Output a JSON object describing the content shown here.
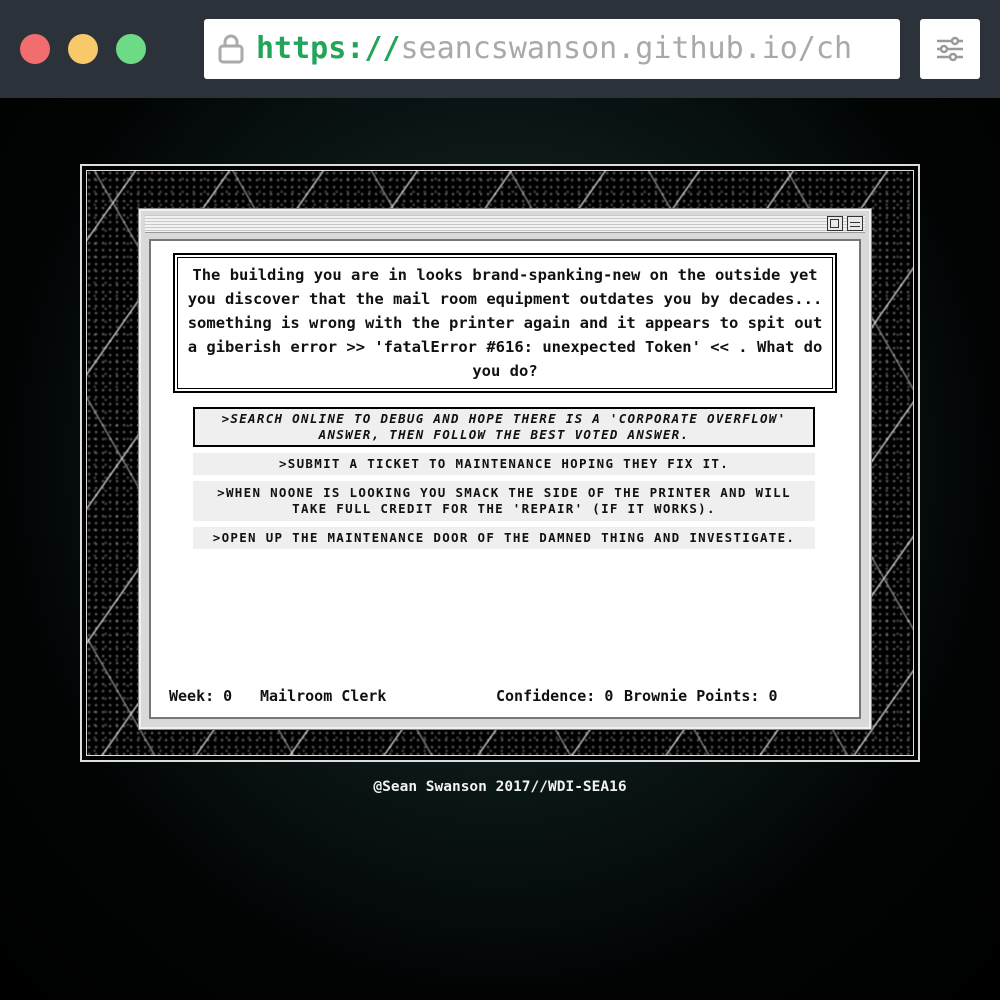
{
  "browser": {
    "url_scheme": "https://",
    "url_rest": "seancswanson.github.io/ch"
  },
  "game": {
    "story": "The building you are in looks brand-spanking-new on the outside yet you discover that the mail room equipment outdates you by decades... something is wrong with the printer again and it appears to spit out a giberish error >> 'fatalError #616: unexpected Token' << . What do you do?",
    "options": [
      {
        "label": ">SEARCH ONLINE TO DEBUG AND HOPE THERE IS A 'CORPORATE OVERFLOW' ANSWER, THEN FOLLOW THE BEST VOTED ANSWER.",
        "selected": true
      },
      {
        "label": ">SUBMIT A TICKET TO MAINTENANCE HOPING THEY FIX IT.",
        "selected": false
      },
      {
        "label": ">WHEN NOONE IS LOOKING YOU SMACK THE SIDE OF THE PRINTER AND WILL TAKE FULL CREDIT FOR THE 'REPAIR' (IF IT WORKS).",
        "selected": false
      },
      {
        "label": ">OPEN UP THE MAINTENANCE DOOR OF THE DAMNED THING AND INVESTIGATE.",
        "selected": false
      }
    ],
    "status": {
      "week": "Week: 0",
      "role": "Mailroom Clerk",
      "confidence": "Confidence: 0",
      "brownie_points": "Brownie Points: 0"
    }
  },
  "footer": "@Sean Swanson 2017//WDI-SEA16",
  "colors": {
    "url_scheme": "#23a559",
    "close": "#f26d6d",
    "minimize": "#f7c96a",
    "maximize": "#6ddb86"
  }
}
